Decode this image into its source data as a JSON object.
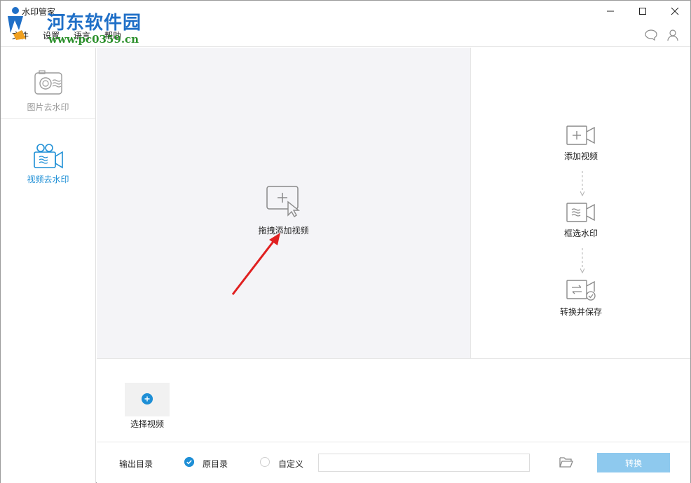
{
  "window": {
    "title": "水印管家"
  },
  "watermark": {
    "brand": "河东软件园",
    "url": "www.pc0359.cn"
  },
  "menu": {
    "file": "文件",
    "settings": "设置",
    "language": "语言",
    "help": "帮助"
  },
  "sidebar": {
    "items": [
      {
        "label": "图片去水印",
        "icon": "photo-camera-icon",
        "active": false
      },
      {
        "label": "视频去水印",
        "icon": "video-camera-icon",
        "active": true
      }
    ]
  },
  "dropzone": {
    "label": "拖拽添加视频"
  },
  "steps": [
    {
      "label": "添加视频",
      "icon": "add-video-icon"
    },
    {
      "label": "框选水印",
      "icon": "select-watermark-icon"
    },
    {
      "label": "转换并保存",
      "icon": "convert-save-icon"
    }
  ],
  "filearea": {
    "add_label": "选择视频"
  },
  "output": {
    "label": "输出目录",
    "options": [
      {
        "label": "原目录",
        "selected": true
      },
      {
        "label": "自定义",
        "selected": false
      }
    ],
    "path_value": "",
    "convert_label": "转换"
  },
  "colors": {
    "accent": "#1e8fd6",
    "convert_button": "#8ec9ee",
    "dropzone_bg": "#f4f4f7",
    "arrow": "#e02020"
  }
}
